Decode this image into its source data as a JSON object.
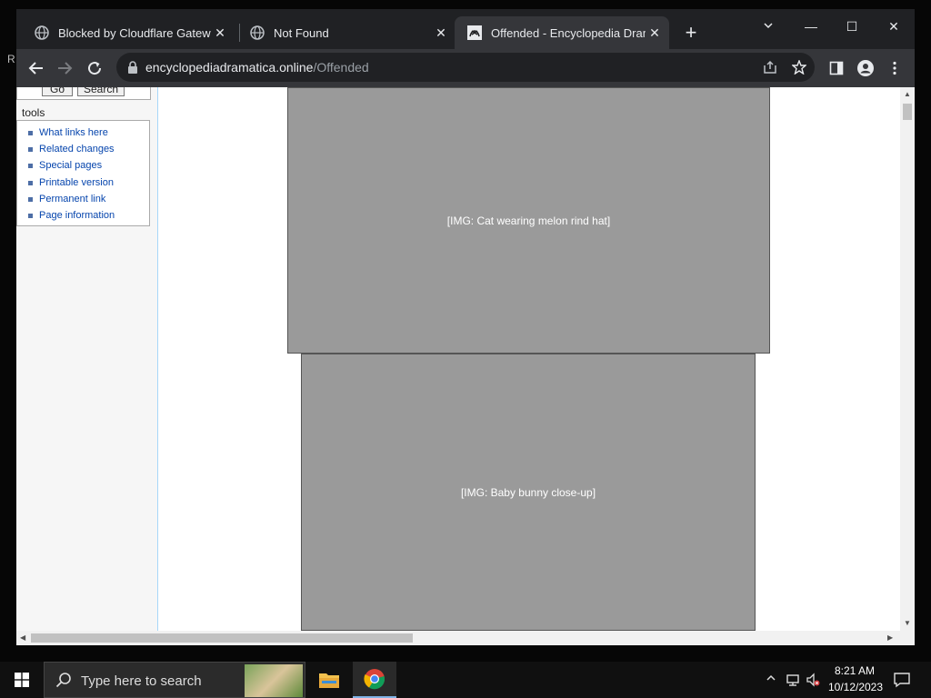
{
  "desktop": {
    "edge_letter": "R"
  },
  "browser": {
    "tabs": [
      {
        "title": "Blocked by Cloudflare Gateway",
        "icon": "globe-icon",
        "active": false
      },
      {
        "title": "Not Found",
        "icon": "globe-icon",
        "active": false
      },
      {
        "title": "Offended - Encyclopedia Dramatica",
        "icon": "site-icon",
        "active": true
      }
    ],
    "window_controls": {
      "minimize": "—",
      "maximize": "☐",
      "close": "✕"
    },
    "address": {
      "host": "encyclopediadramatica.online",
      "path": "/Offended"
    }
  },
  "page": {
    "search_buttons": {
      "go": "Go",
      "search": "Search"
    },
    "tools_heading": "tools",
    "tools_items": [
      "What links here",
      "Related changes",
      "Special pages",
      "Printable version",
      "Permanent link",
      "Page information"
    ],
    "images": [
      {
        "name": "cat-with-melon-rind-hat",
        "alt": "Cat wearing melon rind"
      },
      {
        "name": "baby-bunny",
        "alt": "Baby bunny"
      }
    ]
  },
  "taskbar": {
    "search_placeholder": "Type here to search",
    "time": "8:21 AM",
    "date": "10/12/2023"
  },
  "colors": {
    "chrome_dark": "#202124",
    "toolbar": "#35363a",
    "link_blue": "#0645ad",
    "taskbar": "#101010"
  }
}
